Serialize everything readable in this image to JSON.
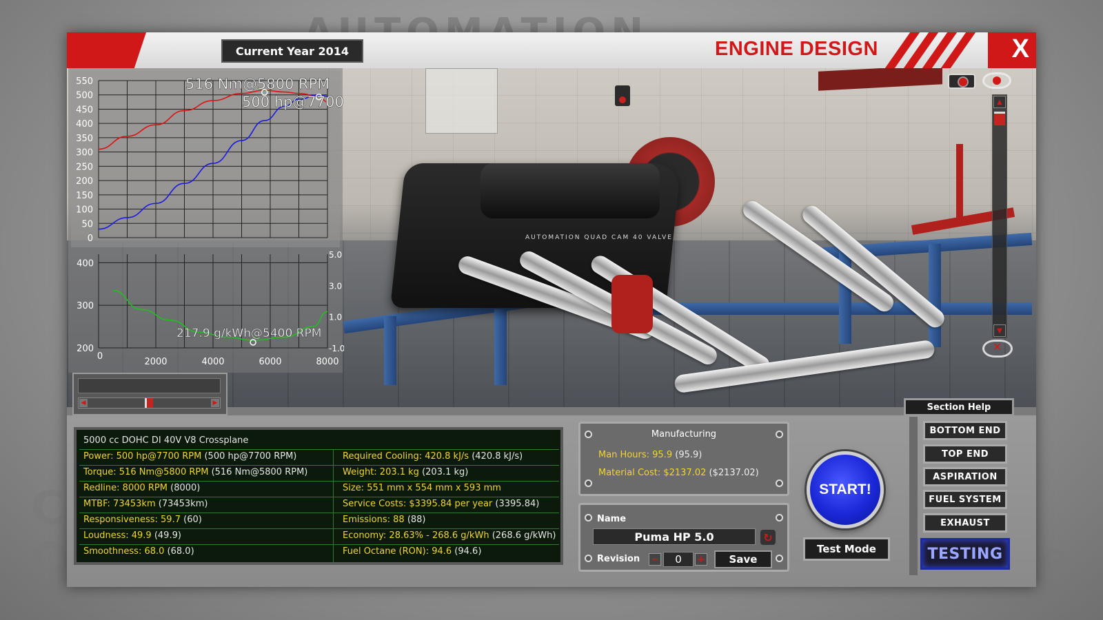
{
  "background": {
    "top_text": "AUTOMATION",
    "left_text_1": "C",
    "left_text_2": "O",
    "right_text": "me"
  },
  "window": {
    "title": "ENGINE DESIGN",
    "year_label": "Current Year 2014",
    "close_label": "X"
  },
  "scene": {
    "engine_branding": "AUTOMATION     QUAD CAM     40 VALVE"
  },
  "chart_data": [
    {
      "type": "line",
      "title": "",
      "x": [
        0,
        1000,
        2000,
        3000,
        4000,
        5000,
        5800,
        6500,
        7000,
        7700,
        8000
      ],
      "xlim": [
        0,
        8000
      ],
      "ylim": [
        0,
        550
      ],
      "yticks": [
        0,
        50,
        100,
        150,
        200,
        250,
        300,
        350,
        400,
        450,
        500,
        550
      ],
      "series": [
        {
          "name": "Torque",
          "color": "#e01010",
          "values": [
            310,
            355,
            395,
            445,
            480,
            505,
            516,
            510,
            505,
            495,
            475
          ]
        },
        {
          "name": "Power",
          "color": "#1a1ae0",
          "values": [
            30,
            70,
            120,
            190,
            260,
            340,
            410,
            460,
            485,
            500,
            495
          ]
        }
      ],
      "annotations": [
        {
          "text": "516 Nm@5800 RPM",
          "x": 5800,
          "y": 516
        },
        {
          "text": "500 hp@7700 RPM",
          "x": 7700,
          "y": 500
        }
      ]
    },
    {
      "type": "line",
      "title": "",
      "x": [
        500,
        1500,
        2500,
        3500,
        4500,
        5400,
        6500,
        7500,
        8000
      ],
      "xlim": [
        0,
        8000
      ],
      "ylim": [
        200,
        420
      ],
      "xticks": [
        0,
        2000,
        4000,
        6000,
        8000
      ],
      "yticks_left": [
        200,
        300,
        400
      ],
      "yticks_right": [
        "-1.0",
        "1.0",
        "3.0",
        "5.0"
      ],
      "series": [
        {
          "name": "BSFC",
          "color": "#20c020",
          "values": [
            335,
            290,
            265,
            237,
            225,
            217.9,
            225,
            250,
            285
          ]
        }
      ],
      "annotations": [
        {
          "text": "217.9 g/kWh@5400 RPM",
          "x": 5400,
          "y": 217.9
        }
      ]
    }
  ],
  "section_help": "Section Help",
  "stats": {
    "header": "5000 cc DOHC DI 40V V8 Crossplane",
    "left": [
      {
        "label": "Power: 500 hp@7700 RPM",
        "paren": "(500 hp@7700 RPM)"
      },
      {
        "label": "Torque: 516 Nm@5800 RPM",
        "paren": "(516 Nm@5800 RPM)"
      },
      {
        "label": "Redline: 8000 RPM",
        "paren": "(8000)"
      },
      {
        "label": "MTBF: 73453km",
        "paren": "(73453km)"
      },
      {
        "label": "Responsiveness: 59.7",
        "paren": "(60)"
      },
      {
        "label": "Loudness: 49.9",
        "paren": "(49.9)"
      },
      {
        "label": "Smoothness: 68.0",
        "paren": "(68.0)"
      }
    ],
    "right": [
      {
        "label": "Required Cooling: 420.8 kJ/s",
        "paren": "(420.8 kJ/s)"
      },
      {
        "label": "Weight: 203.1 kg",
        "paren": "(203.1 kg)"
      },
      {
        "label": "Size: 551 mm x 554 mm x 593 mm",
        "paren": ""
      },
      {
        "label": "Service Costs: $3395.84 per year",
        "paren": "(3395.84)"
      },
      {
        "label": "Emissions: 88",
        "paren": "(88)"
      },
      {
        "label": "Economy: 28.63% - 268.6 g/kWh",
        "paren": "(268.6 g/kWh)"
      },
      {
        "label": "Fuel Octane (RON): 94.6",
        "paren": "(94.6)"
      }
    ]
  },
  "manufacturing": {
    "title": "Manufacturing",
    "man_hours_label": "Man Hours: 95.9",
    "man_hours_paren": "(95.9)",
    "material_label": "Material Cost: $2137.02",
    "material_paren": "($2137.02)"
  },
  "name_box": {
    "name_label": "Name",
    "name_value": "Puma HP 5.0",
    "revision_label": "Revision",
    "revision_value": "0",
    "minus": "−",
    "plus": "+",
    "save_label": "Save"
  },
  "actions": {
    "start_label": "START!",
    "test_mode_label": "Test Mode"
  },
  "nav": {
    "items": [
      "BOTTOM END",
      "TOP END",
      "ASPIRATION",
      "FUEL SYSTEM",
      "EXHAUST"
    ],
    "active_label": "TESTING"
  },
  "colors": {
    "accent_red": "#d01818",
    "stat_yellow": "#f2d62a",
    "start_blue": "#1a28d8"
  }
}
